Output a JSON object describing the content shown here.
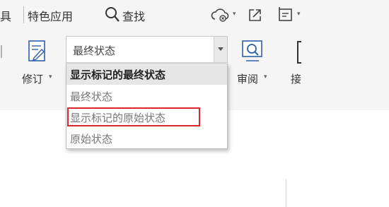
{
  "topbar": {
    "tool_fragment": "具",
    "special_apps": "特色应用",
    "search_label": "查找"
  },
  "review": {
    "revise_label": "修订",
    "review_label": "审阅",
    "partial_label": "接"
  },
  "display_mode": {
    "current_value": "最终状态",
    "options": [
      "显示标记的最终状态",
      "最终状态",
      "显示标记的原始状态",
      "原始状态"
    ],
    "selected_index": 0,
    "highlighted_index": 2
  },
  "colors": {
    "ribbon_bg": "#f5f5f5",
    "highlight": "#d9262b",
    "selected_bg": "#e6e6e6"
  },
  "icons": [
    "search-icon",
    "cloud-sync-icon",
    "share-icon",
    "doc-tool-icon",
    "revise-icon",
    "review-icon"
  ]
}
